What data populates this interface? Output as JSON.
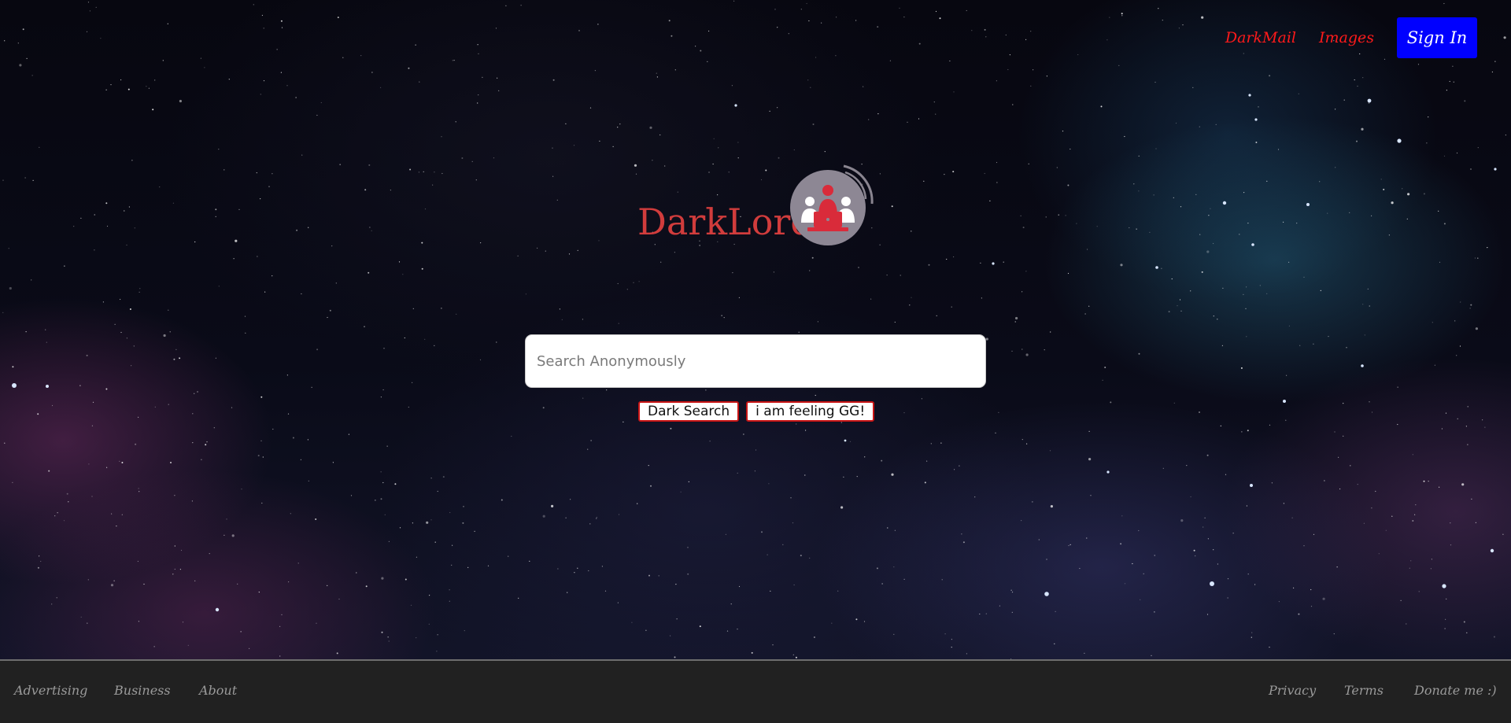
{
  "header": {
    "links": [
      {
        "label": "DarkMail"
      },
      {
        "label": "Images"
      }
    ],
    "signin_label": "Sign In"
  },
  "logo": {
    "text": "DarkLord",
    "icon": "hooded-figures-laptop-icon"
  },
  "search": {
    "placeholder": "Search Anonymously",
    "value": "",
    "primary_button": "Dark Search",
    "secondary_button": "i am feeling GG!"
  },
  "footer": {
    "left_links": [
      "Advertising",
      "Business",
      "About"
    ],
    "right_links": [
      "Privacy",
      "Terms",
      "Donate me :)"
    ]
  },
  "colors": {
    "link_red": "#ff1a1a",
    "signin_blue": "#0000ff",
    "logo_red": "#d13c3c",
    "button_border": "#c81414",
    "footer_bg": "#212121",
    "footer_text": "#9a9a9a"
  }
}
